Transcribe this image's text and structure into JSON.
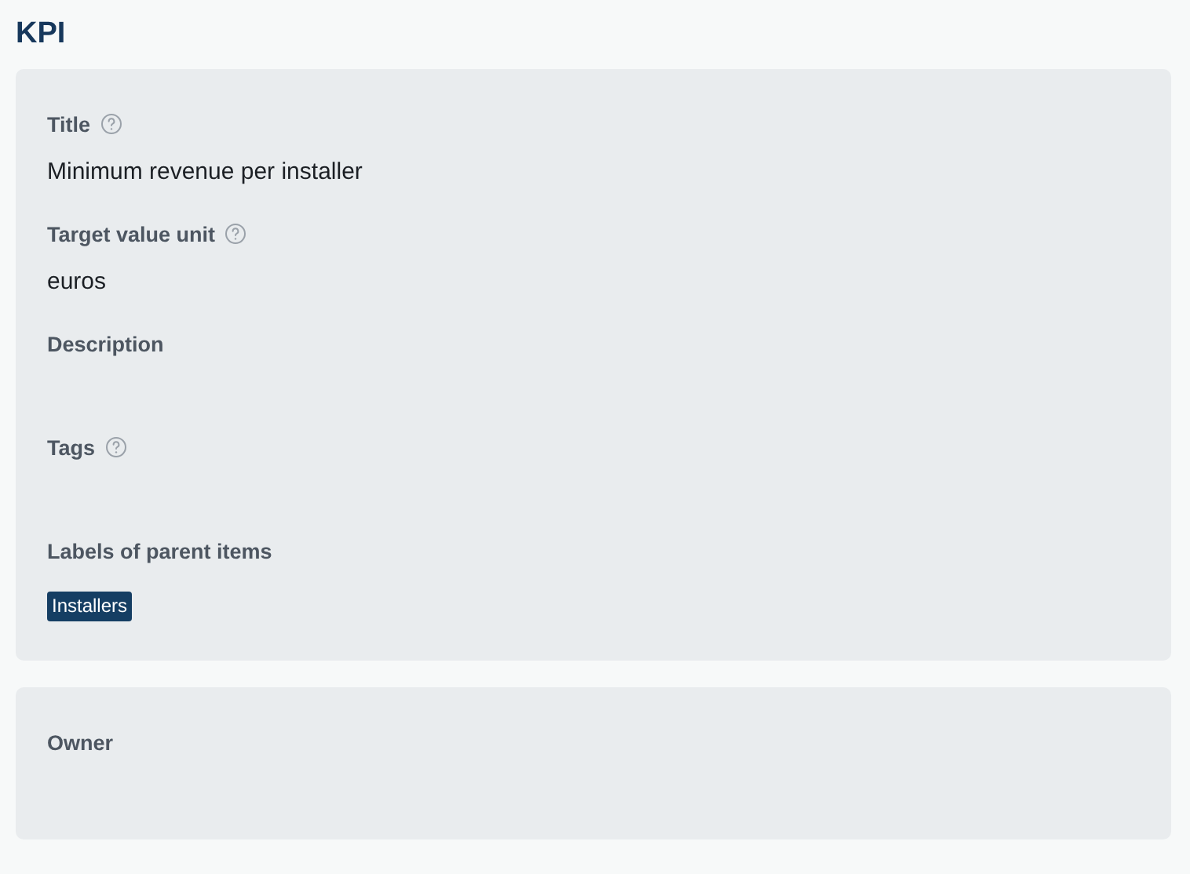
{
  "heading": "KPI",
  "cards": [
    {
      "fields": [
        {
          "kind": "text",
          "label": "Title",
          "help": true,
          "value": "Minimum revenue per installer"
        },
        {
          "kind": "text",
          "label": "Target value unit",
          "help": true,
          "value": "euros"
        },
        {
          "kind": "empty",
          "label": "Description",
          "help": false
        },
        {
          "kind": "empty",
          "label": "Tags",
          "help": true
        },
        {
          "kind": "tags",
          "label": "Labels of parent items",
          "help": false,
          "tags": [
            "Installers"
          ]
        }
      ]
    },
    {
      "fields": [
        {
          "kind": "empty",
          "label": "Owner",
          "help": false
        }
      ]
    }
  ]
}
